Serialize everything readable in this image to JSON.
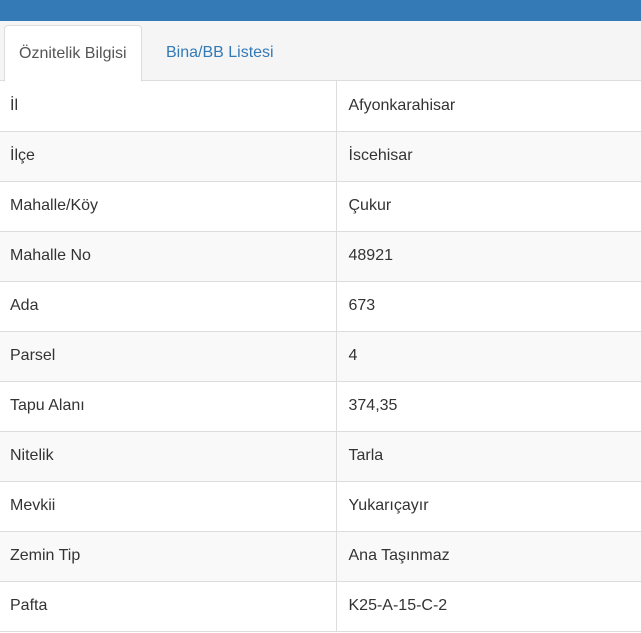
{
  "colors": {
    "header_bar": "#337ab7",
    "link": "#337ab7",
    "tab_strip_bg": "#f5f5f5",
    "row_stripe": "#f9f9f9",
    "border": "#dddddd"
  },
  "tabs": [
    {
      "label": "Öznitelik Bilgisi",
      "active": true
    },
    {
      "label": "Bina/BB Listesi",
      "active": false
    }
  ],
  "attributes": [
    {
      "key": "İl",
      "value": "Afyonkarahisar"
    },
    {
      "key": "İlçe",
      "value": "İscehisar"
    },
    {
      "key": "Mahalle/Köy",
      "value": "Çukur"
    },
    {
      "key": "Mahalle No",
      "value": "48921"
    },
    {
      "key": "Ada",
      "value": "673"
    },
    {
      "key": "Parsel",
      "value": "4"
    },
    {
      "key": "Tapu Alanı",
      "value": "374,35"
    },
    {
      "key": "Nitelik",
      "value": "Tarla"
    },
    {
      "key": "Mevkii",
      "value": "Yukarıçayır"
    },
    {
      "key": "Zemin Tip",
      "value": "Ana Taşınmaz"
    },
    {
      "key": "Pafta",
      "value": "K25-A-15-C-2"
    }
  ]
}
